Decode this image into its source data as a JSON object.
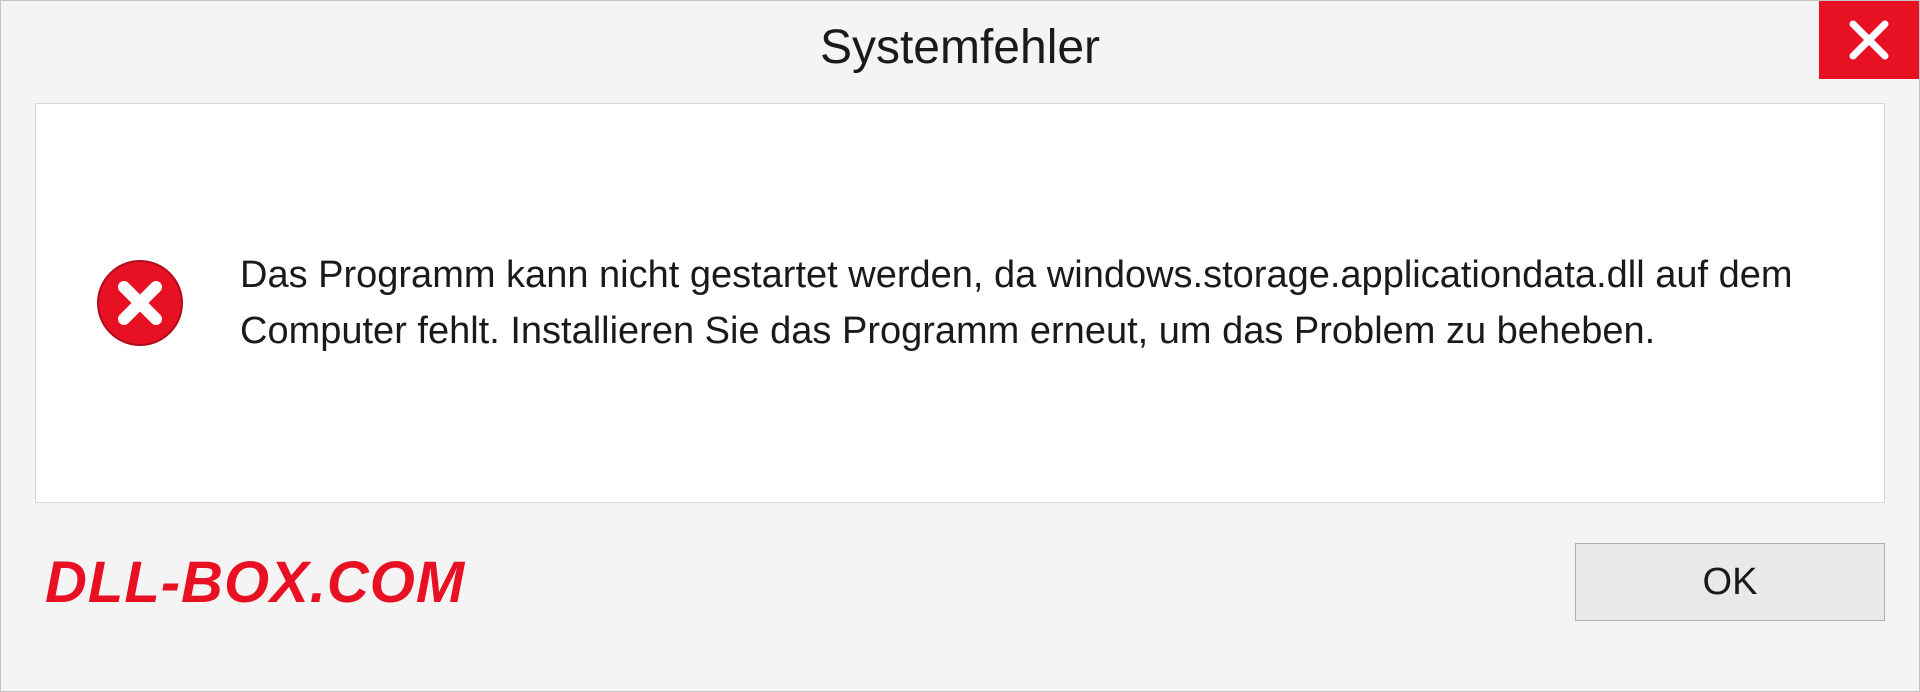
{
  "dialog": {
    "title": "Systemfehler",
    "message": "Das Programm kann nicht gestartet werden, da windows.storage.applicationdata.dll auf dem Computer fehlt. Installieren Sie das Programm erneut, um das Problem zu beheben.",
    "ok_label": "OK"
  },
  "watermark": "DLL-BOX.COM"
}
